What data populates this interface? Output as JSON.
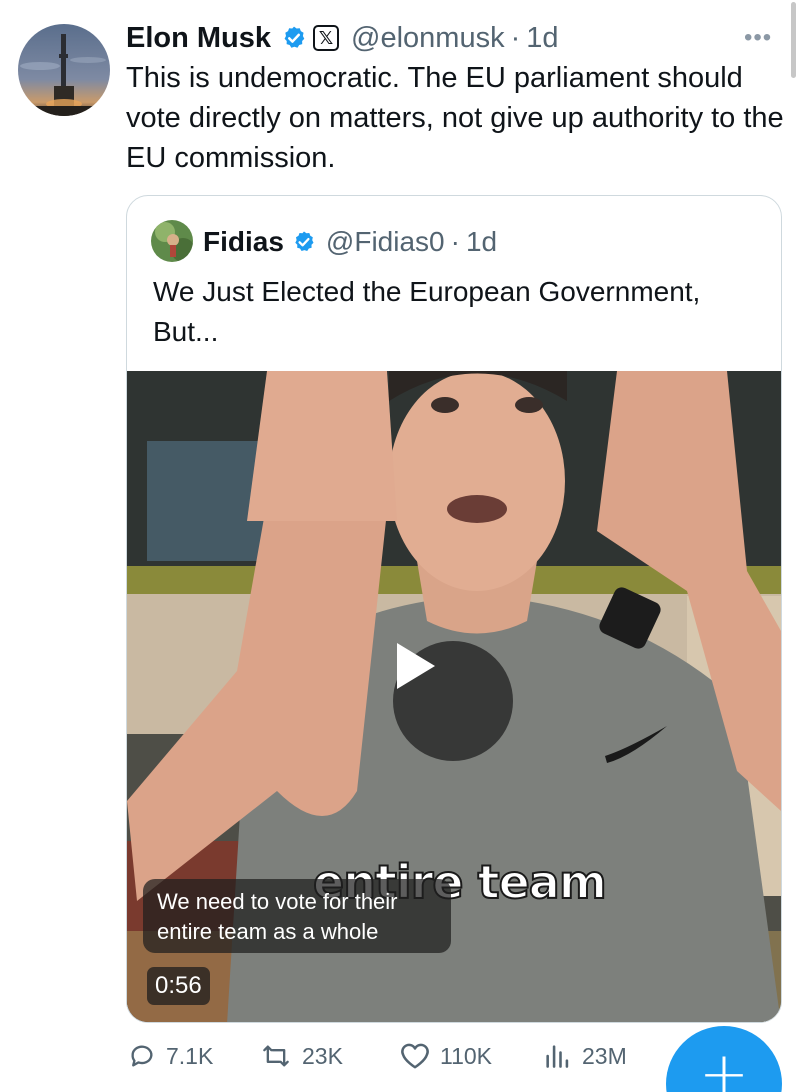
{
  "tweet": {
    "author_name": "Elon Musk",
    "handle": "@elonmusk",
    "separator": "·",
    "time": "1d",
    "more_label": "•••",
    "x_badge": "𝕏",
    "text": "This is undemocratic. The EU parliament should vote directly on matters, not give up authority to the EU commission."
  },
  "quote": {
    "author_name": "Fidias",
    "handle": "@Fidias0",
    "separator": "·",
    "time": "1d",
    "text": "We Just Elected the European Government, But..."
  },
  "video": {
    "burned_text": "entire team",
    "caption": "We need to vote for their entire team as a whole",
    "duration": "0:56"
  },
  "actions": {
    "replies": "7.1K",
    "reposts": "23K",
    "likes": "110K",
    "views": "23M"
  },
  "fab": {
    "label": "+"
  },
  "colors": {
    "accent": "#1d9bf0",
    "text_primary": "#0f1419",
    "text_secondary": "#536471",
    "border": "#cfd9de"
  },
  "icons": [
    "verified-icon",
    "x-affiliate-icon",
    "more-icon",
    "play-icon",
    "reply-icon",
    "repost-icon",
    "like-icon",
    "views-icon",
    "compose-icon"
  ]
}
